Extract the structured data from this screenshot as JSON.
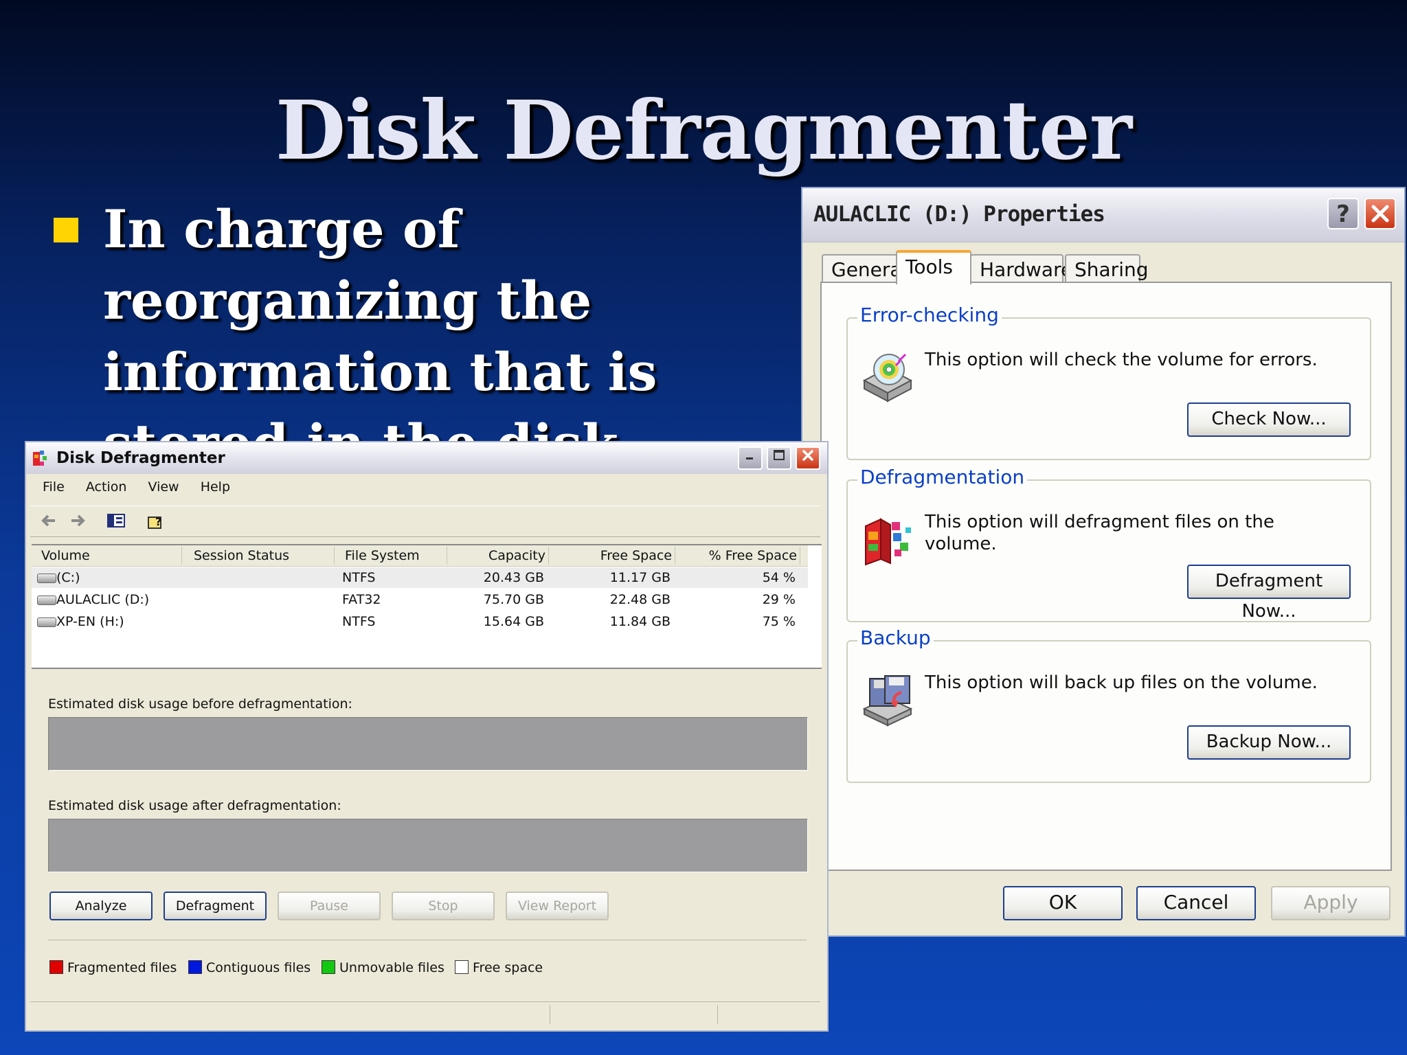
{
  "slide": {
    "title": "Disk Defragmenter",
    "bullet": "In charge of reorganizing the information that is stored in the disk."
  },
  "properties_dialog": {
    "title": "AULACLIC (D:) Properties",
    "help_button": "?",
    "tabs": [
      {
        "label": "General"
      },
      {
        "label": "Tools"
      },
      {
        "label": "Hardware"
      },
      {
        "label": "Sharing"
      }
    ],
    "active_tab": "Tools",
    "groups": [
      {
        "title": "Error-checking",
        "text": "This option will check the volume for errors.",
        "button": "Check Now...",
        "icon": "check-disk-icon"
      },
      {
        "title": "Defragmentation",
        "text": "This option will defragment files on the volume.",
        "button": "Defragment Now...",
        "icon": "defragment-icon"
      },
      {
        "title": "Backup",
        "text": "This option will back up files on the volume.",
        "button": "Backup Now...",
        "icon": "backup-icon"
      }
    ],
    "footer": {
      "ok": "OK",
      "cancel": "Cancel",
      "apply": "Apply"
    }
  },
  "defrag_window": {
    "title": "Disk Defragmenter",
    "menu": [
      "File",
      "Action",
      "View",
      "Help"
    ],
    "columns": [
      "Volume",
      "Session Status",
      "File System",
      "Capacity",
      "Free Space",
      "% Free Space"
    ],
    "rows": [
      {
        "volume": "(C:)",
        "status": "",
        "fs": "NTFS",
        "capacity": "20.43 GB",
        "free": "11.17 GB",
        "pct": "54 %"
      },
      {
        "volume": "AULACLIC (D:)",
        "status": "",
        "fs": "FAT32",
        "capacity": "75.70 GB",
        "free": "22.48 GB",
        "pct": "29 %"
      },
      {
        "volume": "XP-EN (H:)",
        "status": "",
        "fs": "NTFS",
        "capacity": "15.64 GB",
        "free": "11.84 GB",
        "pct": "75 %"
      }
    ],
    "usage_before_label": "Estimated disk usage before defragmentation:",
    "usage_after_label": "Estimated disk usage after defragmentation:",
    "buttons": {
      "analyze": "Analyze",
      "defragment": "Defragment",
      "pause": "Pause",
      "stop": "Stop",
      "view_report": "View Report"
    },
    "legend": [
      {
        "label": "Fragmented files",
        "color": "#e00000"
      },
      {
        "label": "Contiguous files",
        "color": "#0018e0"
      },
      {
        "label": "Unmovable files",
        "color": "#12c812"
      },
      {
        "label": "Free space",
        "color": "#ffffff"
      }
    ]
  },
  "colors": {
    "accent_blue": "#0a3fc9",
    "bullet_yellow": "#ffd400",
    "close_red": "#c83414"
  }
}
